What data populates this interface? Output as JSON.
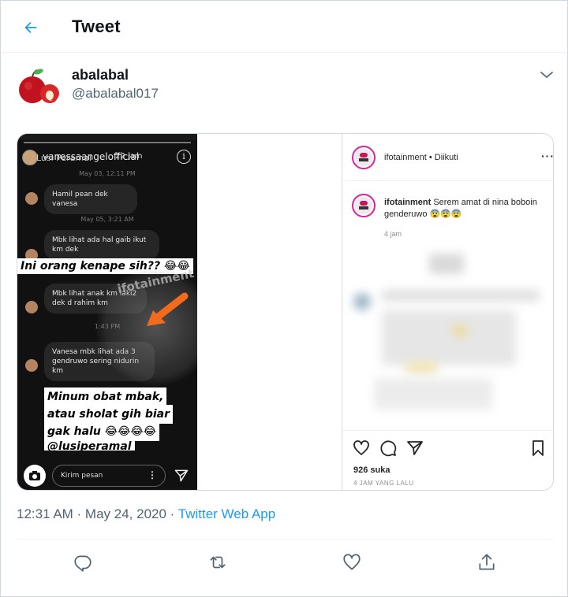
{
  "header": {
    "title": "Tweet"
  },
  "author": {
    "name": "abalabal",
    "handle": "@abalabal017"
  },
  "media": {
    "story": {
      "username": "vanessaangelofficial",
      "time": "22 jam",
      "title_overlay": "Lusi Peramal",
      "messages": [
        {
          "stamp": "May 03, 12:11 PM",
          "text": "Hamil pean dek vanesa"
        },
        {
          "stamp": "May 05, 3:21 AM",
          "text": "Mbk lihat ada hal gaib ikut km dek"
        },
        {
          "stamp": "",
          "text": "Mbk lihat anak km laki2 dek d rahim km"
        },
        {
          "stamp": "1:43 PM",
          "text": "Vanesa mbk lihat ada 3 gendruwo sering nidurin km"
        }
      ],
      "banner_1": "Ini orang kenape sih?? 😂😂",
      "banner_2": [
        "Minum obat mbak,",
        "atau sholat gih biar",
        "gak halu 😂😂😂😂",
        "@lusiperamal"
      ],
      "watermark": "ifotainment",
      "input_placeholder": "Kirim pesan"
    },
    "instagram": {
      "account": "ifotainment • Diikuti",
      "caption_user": "ifotainment",
      "caption_text": "Serem amat di nina boboin genderuwo 😨😨😨",
      "ago": "4 jam",
      "likes": "926 suka",
      "when": "4 JAM YANG LALU"
    }
  },
  "meta": {
    "time": "12:31 AM · May 24, 2020 · ",
    "source": "Twitter Web App"
  },
  "colors": {
    "accent": "#1d9bf0",
    "secondary": "#536471",
    "divider": "#eff3f4"
  }
}
